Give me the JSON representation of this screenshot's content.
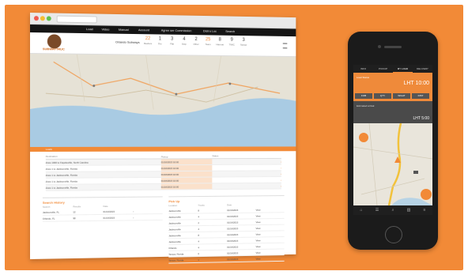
{
  "browser": {
    "nav": [
      "Load",
      "Video",
      "Manual",
      "Account",
      "Agree ser Commission",
      "Distru Loc",
      "Search"
    ],
    "brand": "SUBWAYTRUC",
    "company_label": "Orlando Subways",
    "stats": [
      {
        "value": "22",
        "label": "Reefers",
        "highlight": true
      },
      {
        "value": "1",
        "label": "Dry"
      },
      {
        "value": "3",
        "label": "Flat"
      },
      {
        "value": "4",
        "label": "Step"
      },
      {
        "value": "2",
        "label": "Other"
      },
      {
        "value": "25",
        "label": "Team",
        "highlight": true
      },
      {
        "value": "8",
        "label": "Hazmat"
      },
      {
        "value": "9",
        "label": "TWIC"
      },
      {
        "value": "3",
        "label": "Tanker"
      }
    ],
    "section_bar": "Loads",
    "table": {
      "headers": [
        "Destination",
        "Pickup",
        "Status",
        ""
      ],
      "rows": [
        [
          "Zone 1000 to Fayetteville, North Carolina",
          "01/16/2015 10:00",
          "",
          "›"
        ],
        [
          "Zone 1 to Jacksonville, Florida",
          "01/16/2015 10:00",
          "",
          "›"
        ],
        [
          "Zone 1 to Jacksonville, Florida",
          "01/16/2015 10:00",
          "",
          "›"
        ],
        [
          "Zone 1 to Jacksonville, Florida",
          "01/16/2015 10:00",
          "",
          "›"
        ],
        [
          "Zone 1 to Jacksonville, Florida",
          "01/16/2015 10:00",
          "",
          "›"
        ]
      ]
    },
    "panel_left": {
      "title": "Search History",
      "headers": [
        "Search",
        "Results",
        "Date",
        ""
      ],
      "rows": [
        [
          "Jacksonville, FL",
          "12",
          "01/14/2015",
          "›"
        ],
        [
          "Orlando, FL",
          "98",
          "01/14/2015",
          "›"
        ]
      ]
    },
    "panel_right": {
      "title": "Pick Up",
      "headers": [
        "Location",
        "Trucks",
        "Date",
        ""
      ],
      "rows": [
        [
          "Jacksonville",
          "8",
          "01/16/2015",
          "View"
        ],
        [
          "Jacksonville",
          "4",
          "01/16/2015",
          "View"
        ],
        [
          "Jacksonville",
          "2",
          "01/16/2015",
          "View"
        ],
        [
          "Jacksonville",
          "4",
          "01/16/2015",
          "View"
        ],
        [
          "Jacksonville",
          "8",
          "01/16/2015",
          "View"
        ],
        [
          "Jacksonville",
          "4",
          "01/16/2015",
          "View"
        ],
        [
          "Orlando",
          "4",
          "01/16/2015",
          "View"
        ],
        [
          "Tampa, Florida",
          "6",
          "01/16/2015",
          "View"
        ],
        [
          "Tampa, Florida",
          "1",
          "01/16/2015",
          "View"
        ]
      ]
    }
  },
  "phone": {
    "tabs": [
      "INFO",
      "PICKUP",
      "MY LOAD",
      "DELIVERY"
    ],
    "active_tab": "MY LOAD",
    "header_small": "Load Status",
    "header_big": "LHT 10:00",
    "segments": [
      "FOB",
      "QTY",
      "WGHT",
      "DIST"
    ],
    "band_label": "Estimated arrival",
    "band_value": "LHT 5:00",
    "nav_icons": [
      "home-icon",
      "list-icon",
      "search-icon",
      "chart-icon",
      "menu-icon"
    ]
  },
  "colors": {
    "accent": "#f28a37",
    "dark": "#1b1b1b"
  }
}
